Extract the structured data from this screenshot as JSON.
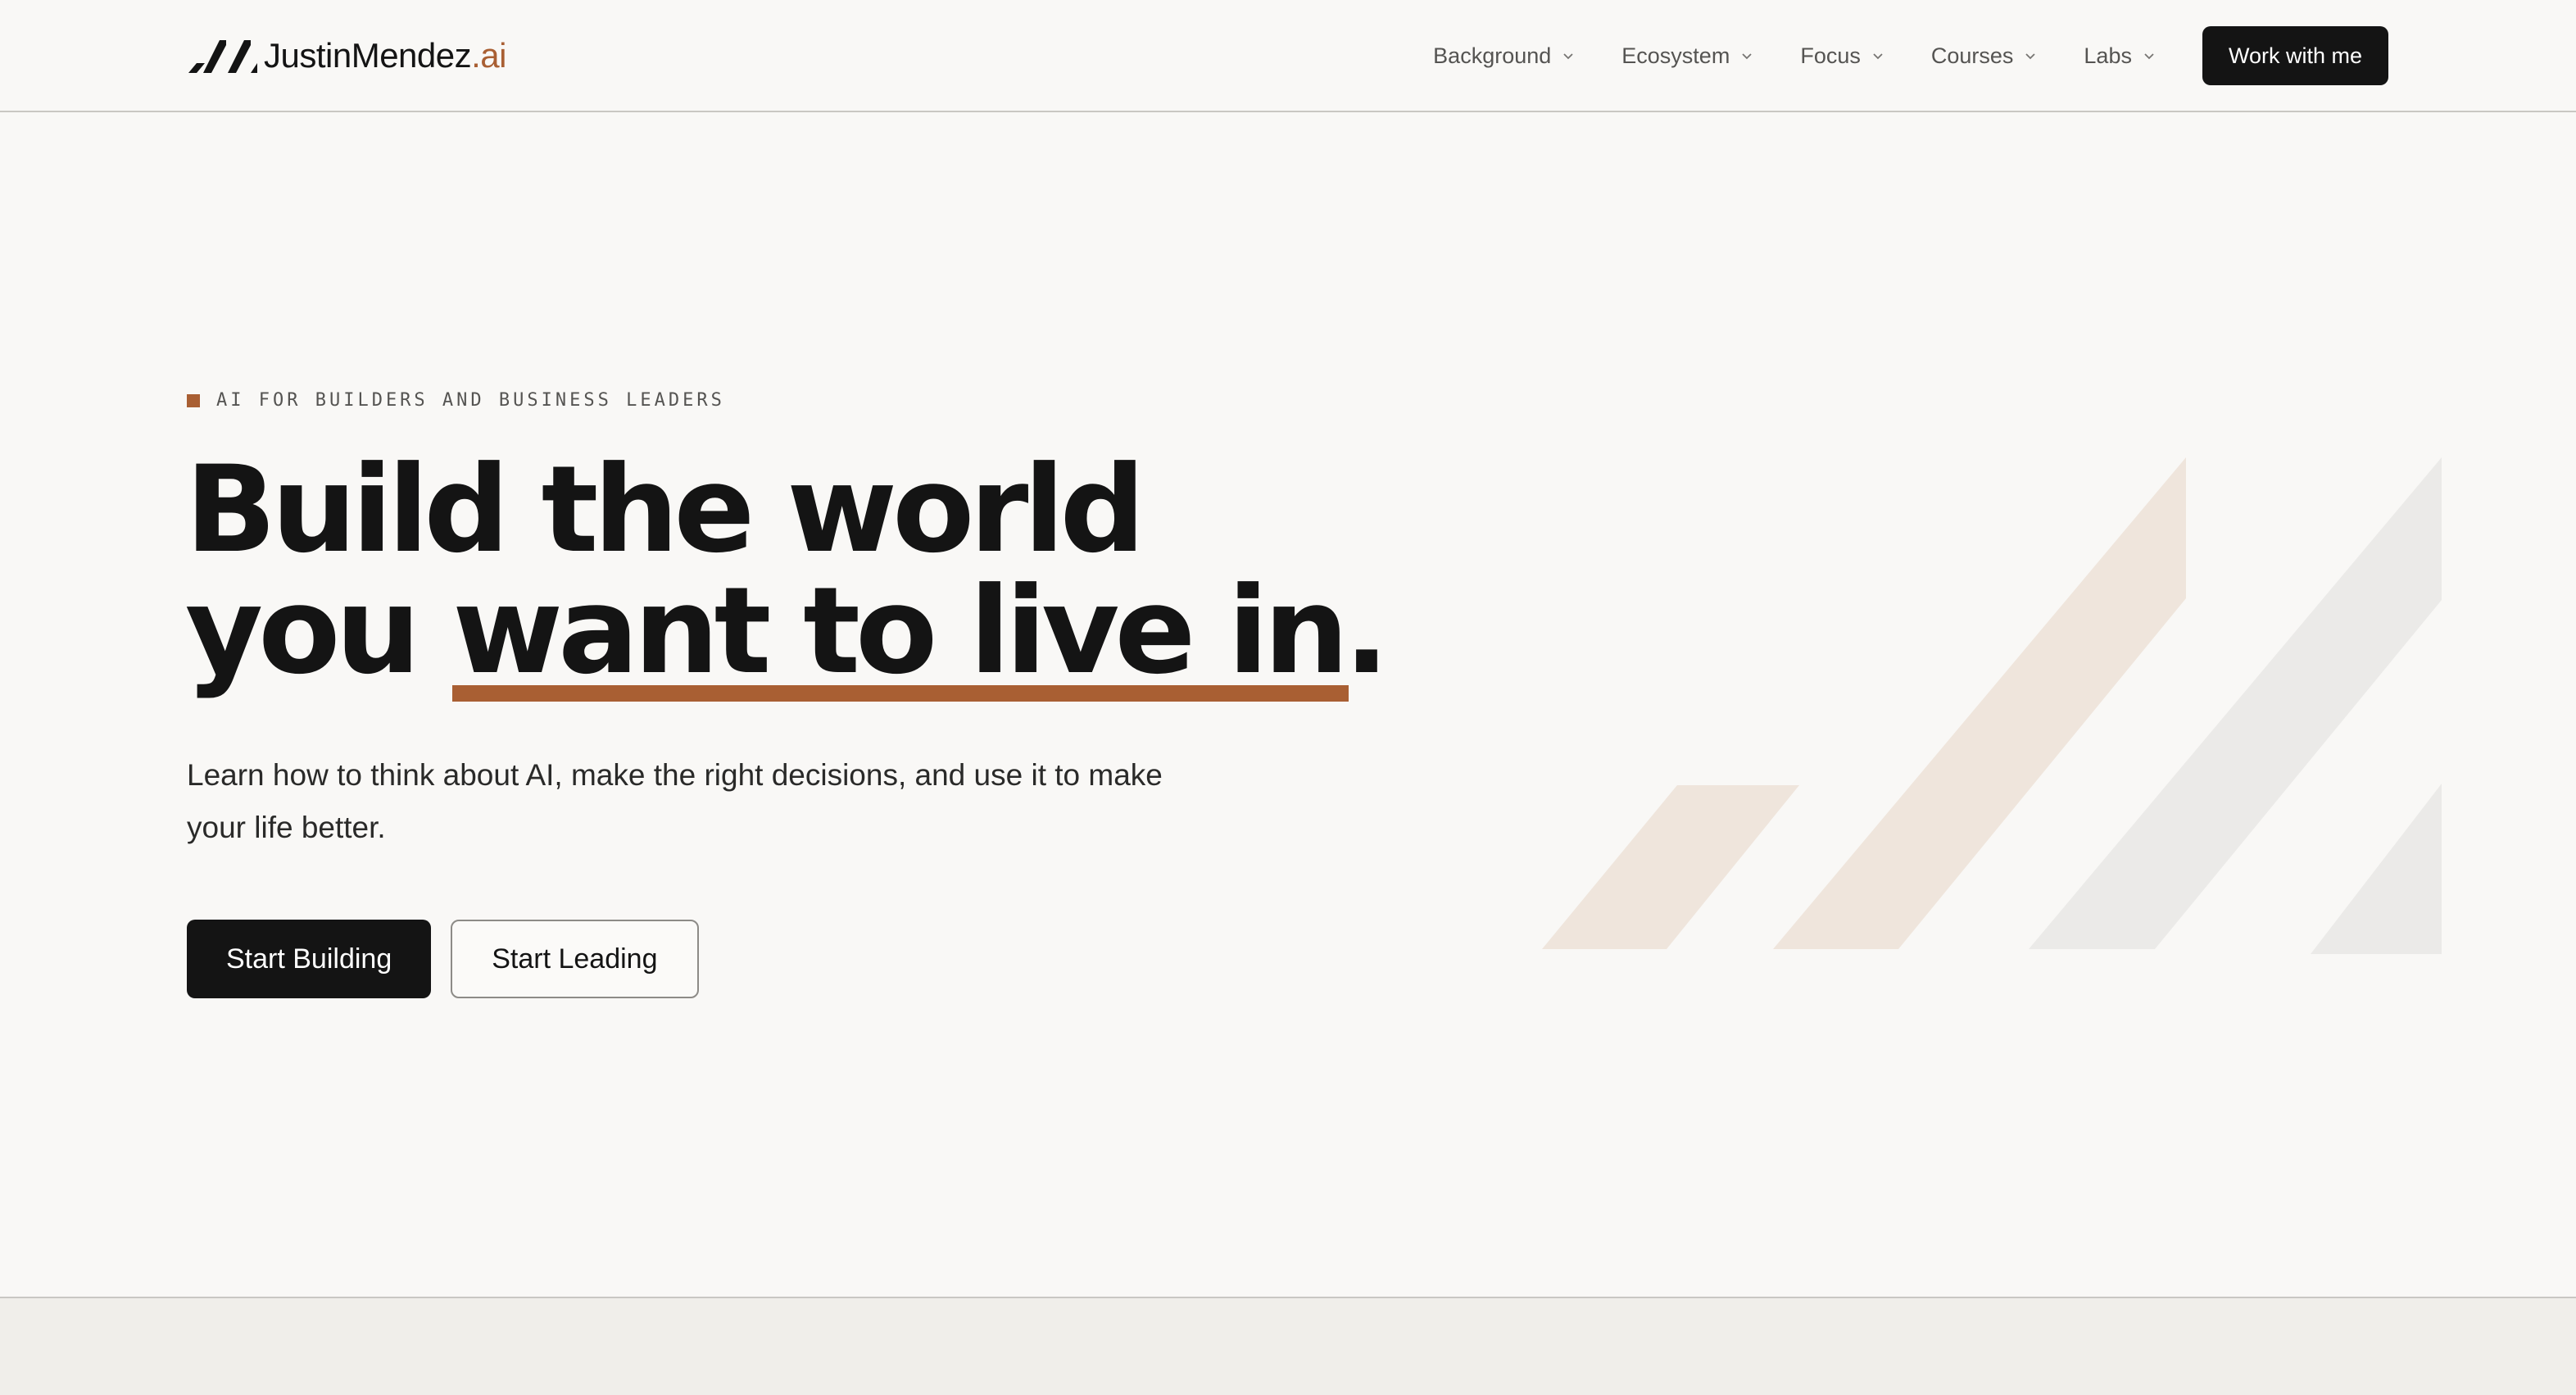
{
  "header": {
    "logo": {
      "name": "JustinMendez",
      "accent": ".ai",
      "icon": "logo-slashes-icon"
    },
    "nav": [
      {
        "label": "Background",
        "icon": "chevron-down-icon"
      },
      {
        "label": "Ecosystem",
        "icon": "chevron-down-icon"
      },
      {
        "label": "Focus",
        "icon": "chevron-down-icon"
      },
      {
        "label": "Courses",
        "icon": "chevron-down-icon"
      },
      {
        "label": "Labs",
        "icon": "chevron-down-icon"
      }
    ],
    "cta_label": "Work with me"
  },
  "hero": {
    "eyebrow": "AI FOR BUILDERS AND BUSINESS LEADERS",
    "headline": {
      "line1": "Build the world",
      "line2_prefix": "you ",
      "line2_underlined": "want to live in",
      "line2_suffix": "."
    },
    "subtitle": "Learn how to think about AI, make the right decisions, and use it to make your life better.",
    "primary_button": "Start Building",
    "secondary_button": "Start Leading",
    "graphic_icon": "brand-slashes-graphic"
  },
  "colors": {
    "accent": "#a95f33",
    "text": "#141414",
    "background": "#f9f8f6",
    "graphic_warm": "#efe5dc",
    "graphic_gray": "#ebeae8"
  }
}
